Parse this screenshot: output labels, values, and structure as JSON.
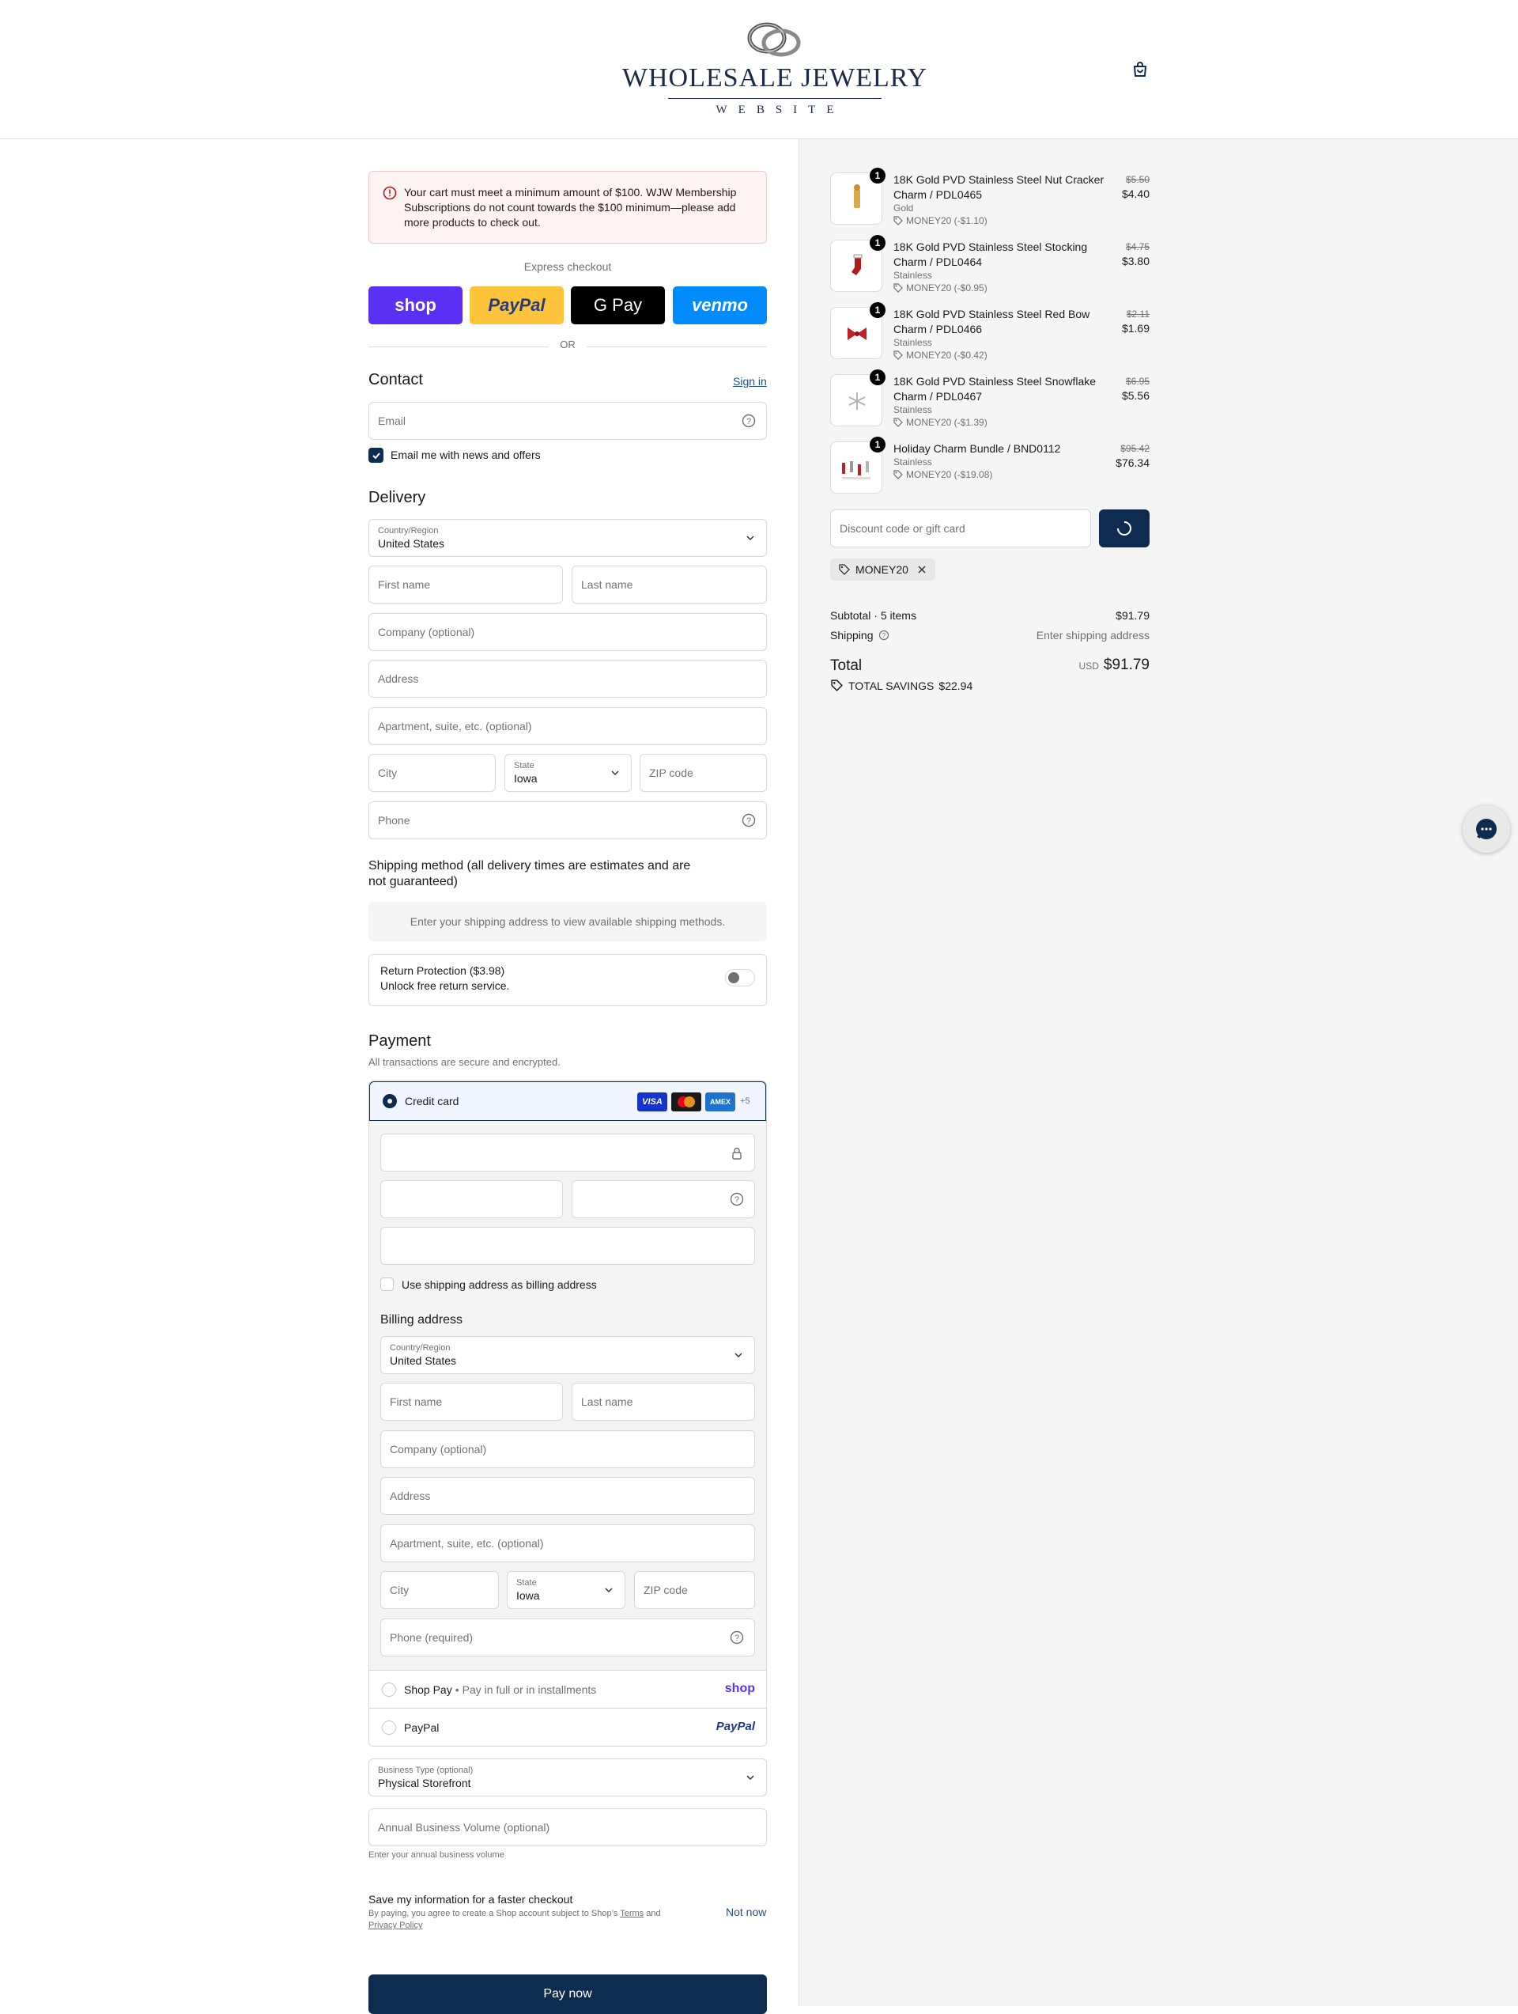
{
  "header": {
    "logo_main": "WHOLESALE JEWELRY",
    "logo_sub": "WEBSITE"
  },
  "alert": {
    "text": "Your cart must meet a minimum amount of $100. WJW Membership Subscriptions do not count towards the $100 minimum—please add more products to check out."
  },
  "express": {
    "title": "Express checkout",
    "buttons": [
      {
        "label": "shop",
        "color": "#5a31f4"
      },
      {
        "label": "PayPal",
        "color": "#ffc439"
      },
      {
        "label": "G Pay",
        "color": "#000000"
      },
      {
        "label": "venmo",
        "color": "#008cff"
      }
    ],
    "or": "OR"
  },
  "contact": {
    "title": "Contact",
    "sign_in": "Sign in",
    "email_placeholder": "Email",
    "newsletter": "Email me with news and offers"
  },
  "delivery": {
    "title": "Delivery",
    "country_label": "Country/Region",
    "country_value": "United States",
    "first_name": "First name",
    "last_name": "Last name",
    "company": "Company (optional)",
    "address": "Address",
    "apartment": "Apartment, suite, etc. (optional)",
    "city": "City",
    "state_label": "State",
    "state_value": "Iowa",
    "zip": "ZIP code",
    "phone": "Phone"
  },
  "shipping": {
    "title": "Shipping method (all delivery times are estimates and are not guaranteed)",
    "notice": "Enter your shipping address to view available shipping methods."
  },
  "return_protection": {
    "title": "Return Protection ($3.98)",
    "subtitle": "Unlock free return service."
  },
  "payment": {
    "title": "Payment",
    "subtitle": "All transactions are secure and encrypted.",
    "credit_card": "Credit card",
    "card_more": "+5",
    "use_shipping": "Use shipping address as billing address",
    "billing_title": "Billing address",
    "billing": {
      "country_label": "Country/Region",
      "country_value": "United States",
      "first_name": "First name",
      "last_name": "Last name",
      "company": "Company (optional)",
      "address": "Address",
      "apartment": "Apartment, suite, etc. (optional)",
      "city": "City",
      "state_label": "State",
      "state_value": "Iowa",
      "zip": "ZIP code",
      "phone": "Phone (required)"
    },
    "shop_pay": "Shop Pay",
    "shop_pay_desc": "Pay in full or in installments",
    "shop_logo": "shop",
    "paypal": "PayPal",
    "paypal_logo": "PayPal"
  },
  "business": {
    "type_label": "Business Type (optional)",
    "type_value": "Physical Storefront",
    "volume_placeholder": "Annual Business Volume (optional)",
    "volume_help": "Enter your annual business volume"
  },
  "save_info": {
    "title": "Save my information for a faster checkout",
    "legal_prefix": "By paying, you agree to create a Shop account subject to Shop’s",
    "terms": "Terms",
    "and": "and",
    "privacy": "Privacy Policy",
    "not_now": "Not now"
  },
  "pay_now": "Pay now",
  "cart": {
    "items": [
      {
        "qty": "1",
        "name": "18K Gold PVD Stainless Steel Nut Cracker Charm / PDL0465",
        "variant": "Gold",
        "discount": "MONEY20 (-$1.10)",
        "old_price": "$5.50",
        "price": "$4.40"
      },
      {
        "qty": "1",
        "name": "18K Gold PVD Stainless Steel Stocking Charm / PDL0464",
        "variant": "Stainless",
        "discount": "MONEY20 (-$0.95)",
        "old_price": "$4.75",
        "price": "$3.80"
      },
      {
        "qty": "1",
        "name": "18K Gold PVD Stainless Steel Red Bow Charm / PDL0466",
        "variant": "Stainless",
        "discount": "MONEY20 (-$0.42)",
        "old_price": "$2.11",
        "price": "$1.69"
      },
      {
        "qty": "1",
        "name": "18K Gold PVD Stainless Steel Snowflake Charm / PDL0467",
        "variant": "Stainless",
        "discount": "MONEY20 (-$1.39)",
        "old_price": "$6.95",
        "price": "$5.56"
      },
      {
        "qty": "1",
        "name": "Holiday Charm Bundle / BND0112",
        "variant": "Stainless",
        "discount": "MONEY20 (-$19.08)",
        "old_price": "$95.42",
        "price": "$76.34"
      }
    ],
    "discount_placeholder": "Discount code or gift card",
    "applied_code": "MONEY20",
    "subtotal_label": "Subtotal · 5 items",
    "subtotal_value": "$91.79",
    "shipping_label": "Shipping",
    "shipping_value": "Enter shipping address",
    "total_label": "Total",
    "currency": "USD",
    "total_value": "$91.79",
    "savings_label": "TOTAL SAVINGS",
    "savings_value": "$22.94"
  }
}
